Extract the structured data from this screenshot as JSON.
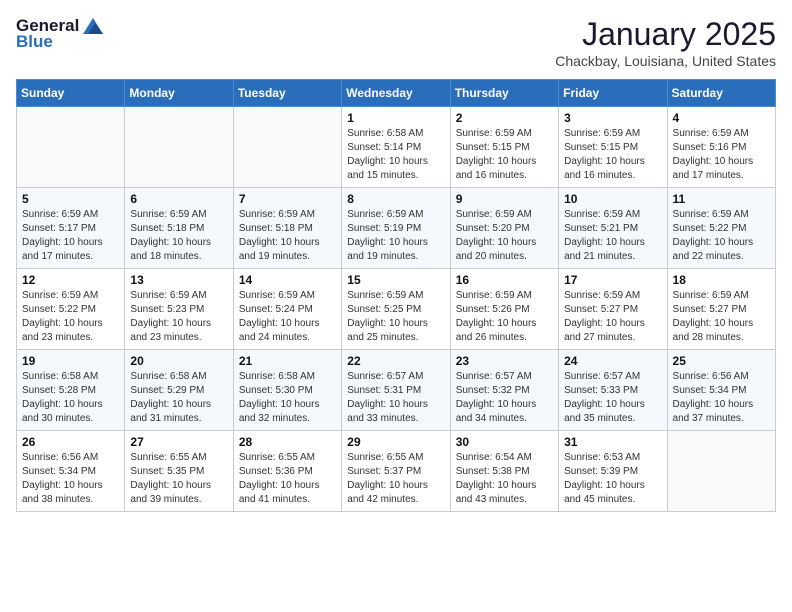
{
  "logo": {
    "general": "General",
    "blue": "Blue"
  },
  "header": {
    "month": "January 2025",
    "location": "Chackbay, Louisiana, United States"
  },
  "weekdays": [
    "Sunday",
    "Monday",
    "Tuesday",
    "Wednesday",
    "Thursday",
    "Friday",
    "Saturday"
  ],
  "weeks": [
    [
      {
        "num": "",
        "info": ""
      },
      {
        "num": "",
        "info": ""
      },
      {
        "num": "",
        "info": ""
      },
      {
        "num": "1",
        "info": "Sunrise: 6:58 AM\nSunset: 5:14 PM\nDaylight: 10 hours\nand 15 minutes."
      },
      {
        "num": "2",
        "info": "Sunrise: 6:59 AM\nSunset: 5:15 PM\nDaylight: 10 hours\nand 16 minutes."
      },
      {
        "num": "3",
        "info": "Sunrise: 6:59 AM\nSunset: 5:15 PM\nDaylight: 10 hours\nand 16 minutes."
      },
      {
        "num": "4",
        "info": "Sunrise: 6:59 AM\nSunset: 5:16 PM\nDaylight: 10 hours\nand 17 minutes."
      }
    ],
    [
      {
        "num": "5",
        "info": "Sunrise: 6:59 AM\nSunset: 5:17 PM\nDaylight: 10 hours\nand 17 minutes."
      },
      {
        "num": "6",
        "info": "Sunrise: 6:59 AM\nSunset: 5:18 PM\nDaylight: 10 hours\nand 18 minutes."
      },
      {
        "num": "7",
        "info": "Sunrise: 6:59 AM\nSunset: 5:18 PM\nDaylight: 10 hours\nand 19 minutes."
      },
      {
        "num": "8",
        "info": "Sunrise: 6:59 AM\nSunset: 5:19 PM\nDaylight: 10 hours\nand 19 minutes."
      },
      {
        "num": "9",
        "info": "Sunrise: 6:59 AM\nSunset: 5:20 PM\nDaylight: 10 hours\nand 20 minutes."
      },
      {
        "num": "10",
        "info": "Sunrise: 6:59 AM\nSunset: 5:21 PM\nDaylight: 10 hours\nand 21 minutes."
      },
      {
        "num": "11",
        "info": "Sunrise: 6:59 AM\nSunset: 5:22 PM\nDaylight: 10 hours\nand 22 minutes."
      }
    ],
    [
      {
        "num": "12",
        "info": "Sunrise: 6:59 AM\nSunset: 5:22 PM\nDaylight: 10 hours\nand 23 minutes."
      },
      {
        "num": "13",
        "info": "Sunrise: 6:59 AM\nSunset: 5:23 PM\nDaylight: 10 hours\nand 23 minutes."
      },
      {
        "num": "14",
        "info": "Sunrise: 6:59 AM\nSunset: 5:24 PM\nDaylight: 10 hours\nand 24 minutes."
      },
      {
        "num": "15",
        "info": "Sunrise: 6:59 AM\nSunset: 5:25 PM\nDaylight: 10 hours\nand 25 minutes."
      },
      {
        "num": "16",
        "info": "Sunrise: 6:59 AM\nSunset: 5:26 PM\nDaylight: 10 hours\nand 26 minutes."
      },
      {
        "num": "17",
        "info": "Sunrise: 6:59 AM\nSunset: 5:27 PM\nDaylight: 10 hours\nand 27 minutes."
      },
      {
        "num": "18",
        "info": "Sunrise: 6:59 AM\nSunset: 5:27 PM\nDaylight: 10 hours\nand 28 minutes."
      }
    ],
    [
      {
        "num": "19",
        "info": "Sunrise: 6:58 AM\nSunset: 5:28 PM\nDaylight: 10 hours\nand 30 minutes."
      },
      {
        "num": "20",
        "info": "Sunrise: 6:58 AM\nSunset: 5:29 PM\nDaylight: 10 hours\nand 31 minutes."
      },
      {
        "num": "21",
        "info": "Sunrise: 6:58 AM\nSunset: 5:30 PM\nDaylight: 10 hours\nand 32 minutes."
      },
      {
        "num": "22",
        "info": "Sunrise: 6:57 AM\nSunset: 5:31 PM\nDaylight: 10 hours\nand 33 minutes."
      },
      {
        "num": "23",
        "info": "Sunrise: 6:57 AM\nSunset: 5:32 PM\nDaylight: 10 hours\nand 34 minutes."
      },
      {
        "num": "24",
        "info": "Sunrise: 6:57 AM\nSunset: 5:33 PM\nDaylight: 10 hours\nand 35 minutes."
      },
      {
        "num": "25",
        "info": "Sunrise: 6:56 AM\nSunset: 5:34 PM\nDaylight: 10 hours\nand 37 minutes."
      }
    ],
    [
      {
        "num": "26",
        "info": "Sunrise: 6:56 AM\nSunset: 5:34 PM\nDaylight: 10 hours\nand 38 minutes."
      },
      {
        "num": "27",
        "info": "Sunrise: 6:55 AM\nSunset: 5:35 PM\nDaylight: 10 hours\nand 39 minutes."
      },
      {
        "num": "28",
        "info": "Sunrise: 6:55 AM\nSunset: 5:36 PM\nDaylight: 10 hours\nand 41 minutes."
      },
      {
        "num": "29",
        "info": "Sunrise: 6:55 AM\nSunset: 5:37 PM\nDaylight: 10 hours\nand 42 minutes."
      },
      {
        "num": "30",
        "info": "Sunrise: 6:54 AM\nSunset: 5:38 PM\nDaylight: 10 hours\nand 43 minutes."
      },
      {
        "num": "31",
        "info": "Sunrise: 6:53 AM\nSunset: 5:39 PM\nDaylight: 10 hours\nand 45 minutes."
      },
      {
        "num": "",
        "info": ""
      }
    ]
  ]
}
